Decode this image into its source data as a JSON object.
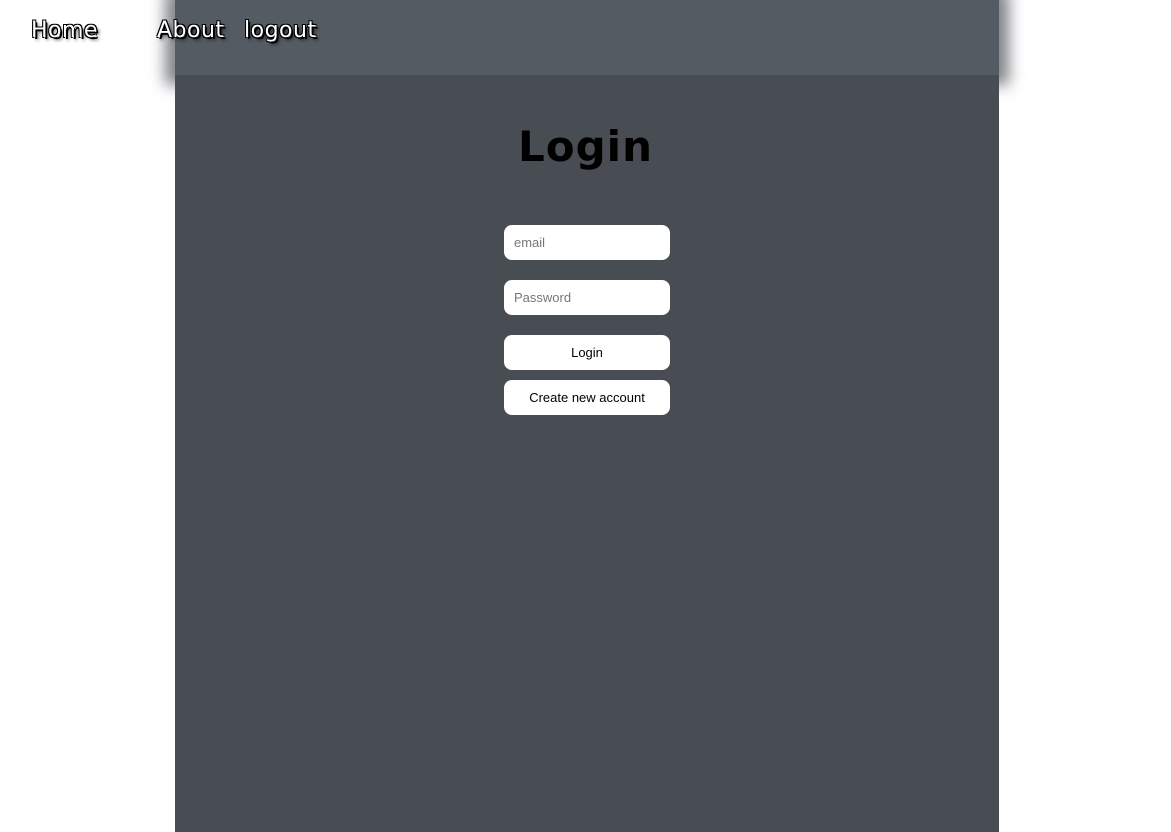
{
  "nav": {
    "home": "Home",
    "about": "About",
    "logout": "logout"
  },
  "login": {
    "title": "Login",
    "email_placeholder": "email",
    "password_placeholder": "Password",
    "login_button": "Login",
    "create_account_button": "Create new account"
  },
  "colors": {
    "header_band": "#555b63",
    "main_panel": "#484c53",
    "page_background": "#ffffff",
    "button_background": "#ffffff"
  }
}
